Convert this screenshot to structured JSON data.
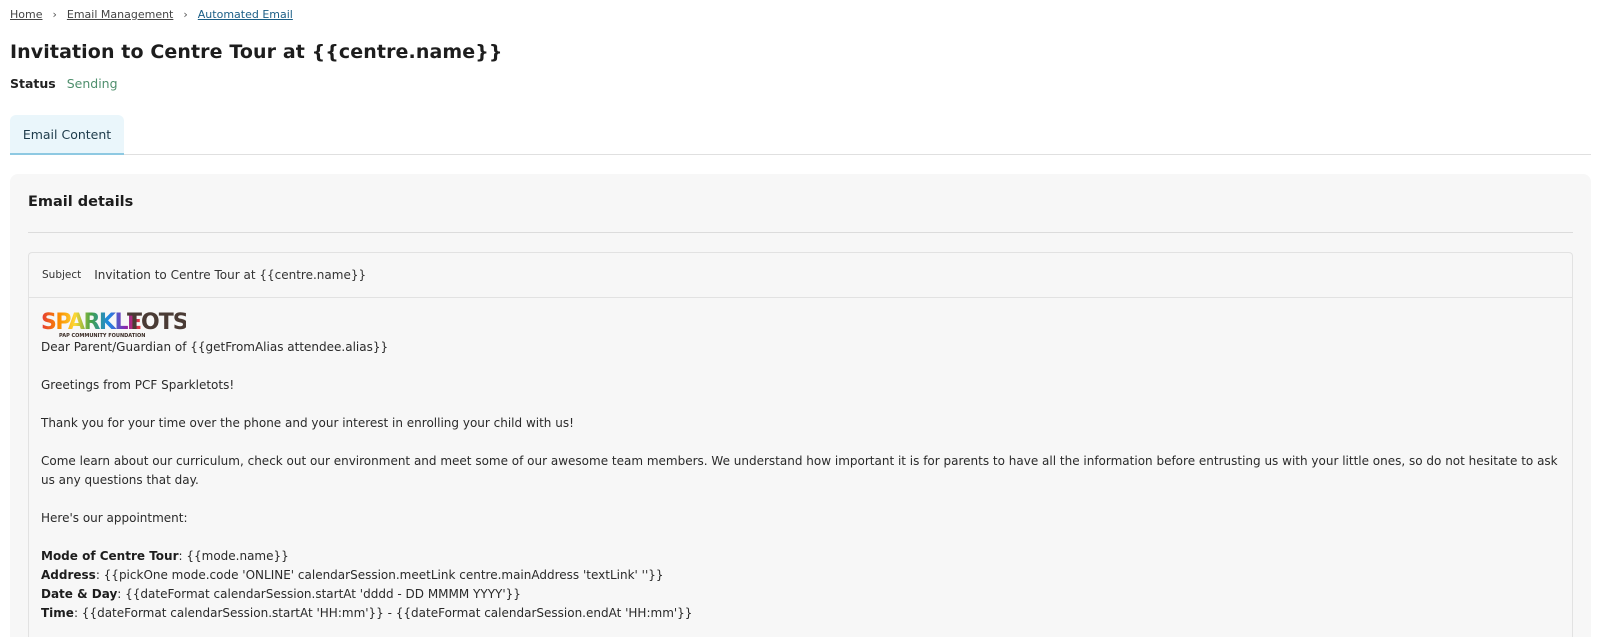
{
  "breadcrumb": {
    "items": [
      "Home",
      "Email Management",
      "Automated Email"
    ]
  },
  "page": {
    "title": "Invitation to Centre Tour at {{centre.name}}",
    "status_label": "Status",
    "status_value": "Sending"
  },
  "tabs": [
    {
      "label": "Email Content",
      "active": true
    }
  ],
  "panel": {
    "title": "Email details"
  },
  "email": {
    "subject_label": "Subject",
    "subject_value": "Invitation to Centre Tour at {{centre.name}}",
    "logo": {
      "text": "SPARKLETOTS",
      "subtext": "PAP COMMUNITY FOUNDATION"
    },
    "body": {
      "greeting": "Dear Parent/Guardian of {{getFromAlias attendee.alias}}",
      "p1": "Greetings from PCF Sparkletots!",
      "p2": "Thank you for your time over the phone and your interest in enrolling your child with us!",
      "p3": "Come learn about our curriculum, check out our environment and meet some of our awesome team members. We understand how important it is for parents to have all the information before entrusting us with your little ones, so do not hesitate to ask us any questions that day.",
      "p4": "Here's our appointment:",
      "details": [
        {
          "label": "Mode of Centre Tour",
          "value": ": {{mode.name}}"
        },
        {
          "label": "Address",
          "value": ": {{pickOne mode.code 'ONLINE' calendarSession.meetLink centre.mainAddress 'textLink' ''}}"
        },
        {
          "label": "Date & Day",
          "value": ": {{dateFormat calendarSession.startAt 'dddd - DD MMMM YYYY'}}"
        },
        {
          "label": "Time",
          "value": ": {{dateFormat calendarSession.startAt 'HH:mm'}} - {{dateFormat calendarSession.endAt 'HH:mm'}}"
        }
      ]
    }
  },
  "colors": {
    "status_green": "#4f8f6d",
    "tab_bg": "#eaf6fb",
    "tab_border": "#8ec9e2",
    "link_current": "#1b5e86"
  }
}
